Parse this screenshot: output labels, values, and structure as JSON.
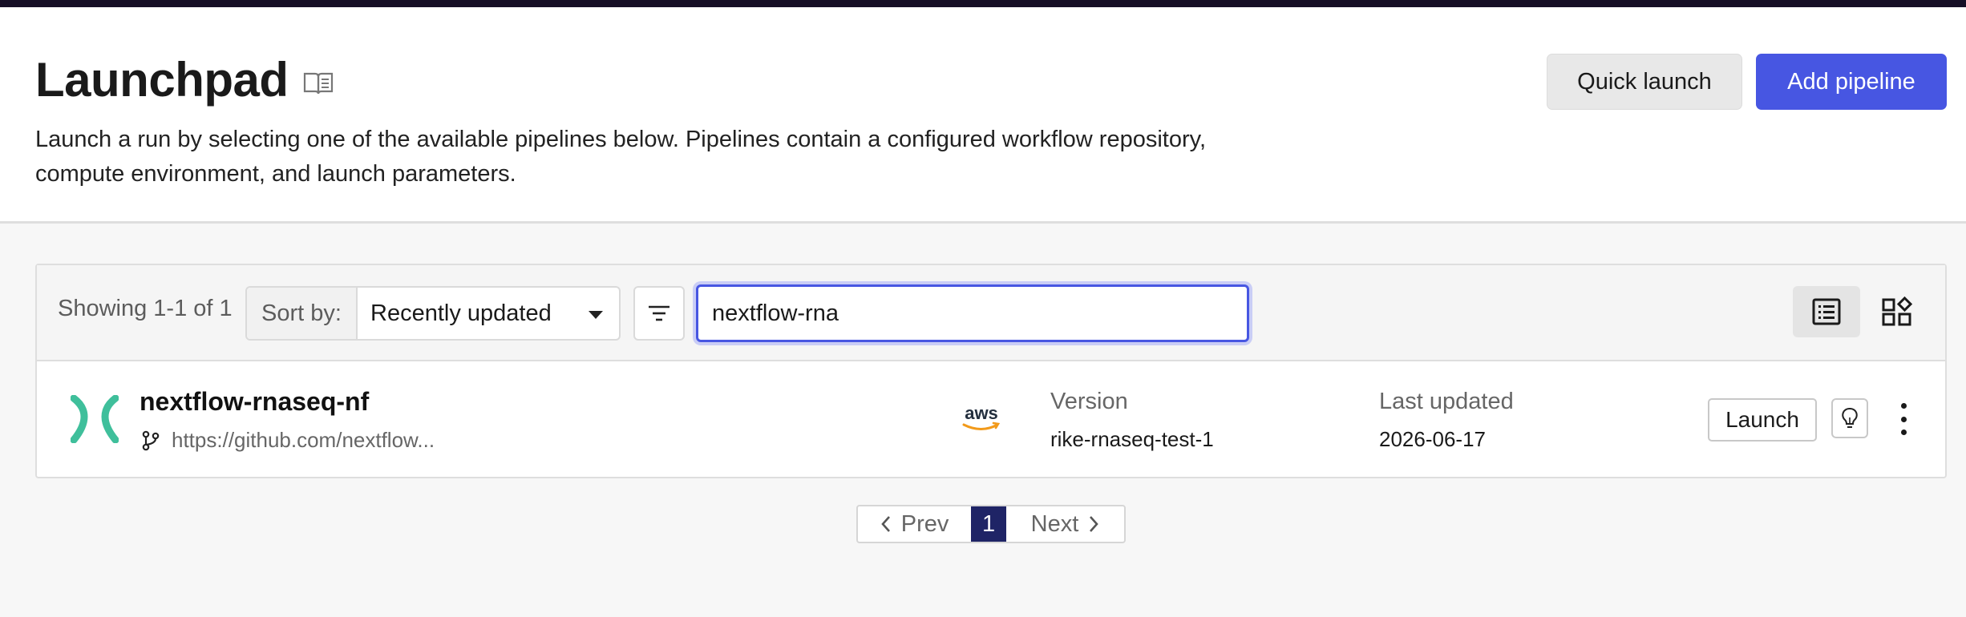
{
  "header": {
    "title": "Launchpad",
    "description": "Launch a run by selecting one of the available pipelines below. Pipelines contain a configured workflow repository, compute environment, and launch parameters.",
    "quick_launch_label": "Quick launch",
    "add_pipeline_label": "Add pipeline",
    "title_icon": "book-icon"
  },
  "toolbar": {
    "showing": "Showing 1-1 of 1",
    "sort_label": "Sort by:",
    "sort_value": "Recently updated",
    "search_value": "nextflow-rna",
    "filter_icon": "filter-icon",
    "list_view_icon": "list-view-icon",
    "grid_view_icon": "grid-view-icon"
  },
  "pipelines": [
    {
      "name": "nextflow-rnaseq-nf",
      "repo": "https://github.com/nextflow...",
      "provider": "aws",
      "version_label": "Version",
      "version": "rike-rnaseq-test-1",
      "updated_label": "Last updated",
      "updated": "2026-06-17",
      "launch_label": "Launch"
    }
  ],
  "pagination": {
    "prev": "Prev",
    "page": "1",
    "next": "Next"
  },
  "colors": {
    "accent": "#4756e2",
    "topbar": "#160f26",
    "logo": "#3fbf9b",
    "page_active": "#1f2466",
    "aws_arrow": "#f29a1a"
  }
}
